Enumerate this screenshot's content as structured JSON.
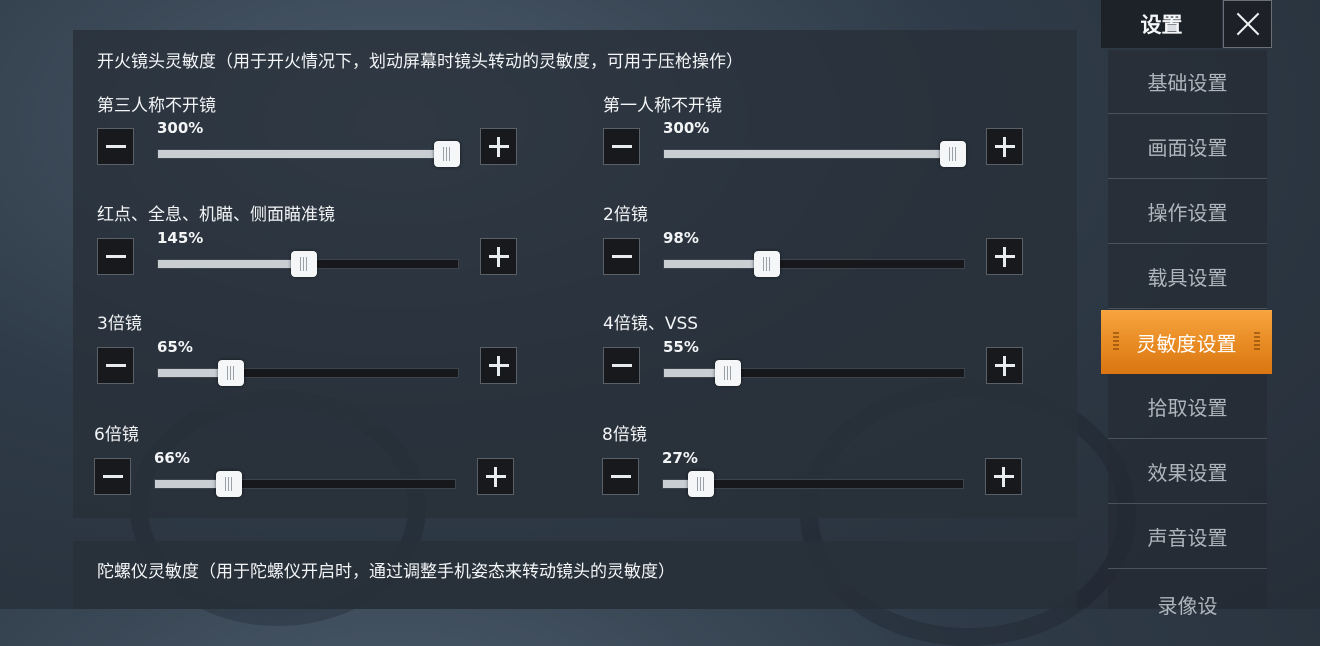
{
  "fire_section": {
    "title": "开火镜头灵敏度（用于开火情况下，划动屏幕时镜头转动的灵敏度，可用于压枪操作）",
    "sliders": [
      {
        "label": "第三人称不开镜",
        "value_label": "300%",
        "value": 300
      },
      {
        "label": "第一人称不开镜",
        "value_label": "300%",
        "value": 300
      },
      {
        "label": "红点、全息、机瞄、侧面瞄准镜",
        "value_label": "145%",
        "value": 145
      },
      {
        "label": "2倍镜",
        "value_label": "98%",
        "value": 98
      },
      {
        "label": "3倍镜",
        "value_label": "65%",
        "value": 65
      },
      {
        "label": "4倍镜、VSS",
        "value_label": "55%",
        "value": 55
      },
      {
        "label": "6倍镜",
        "value_label": "66%",
        "value": 66
      },
      {
        "label": "8倍镜",
        "value_label": "27%",
        "value": 27
      }
    ],
    "slider_min": 0,
    "slider_max": 300
  },
  "gyro_section": {
    "title": "陀螺仪灵敏度（用于陀螺仪开启时，通过调整手机姿态来转动镜头的灵敏度）"
  },
  "sidebar": {
    "title": "设置",
    "close_icon": "close-icon",
    "items": [
      {
        "label": "基础设置"
      },
      {
        "label": "画面设置"
      },
      {
        "label": "操作设置"
      },
      {
        "label": "载具设置"
      },
      {
        "label": "灵敏度设置"
      },
      {
        "label": "拾取设置"
      },
      {
        "label": "效果设置"
      },
      {
        "label": "声音设置"
      },
      {
        "label": "录像设"
      }
    ],
    "active_index": 4
  },
  "colors": {
    "accent": "#f09a30"
  }
}
